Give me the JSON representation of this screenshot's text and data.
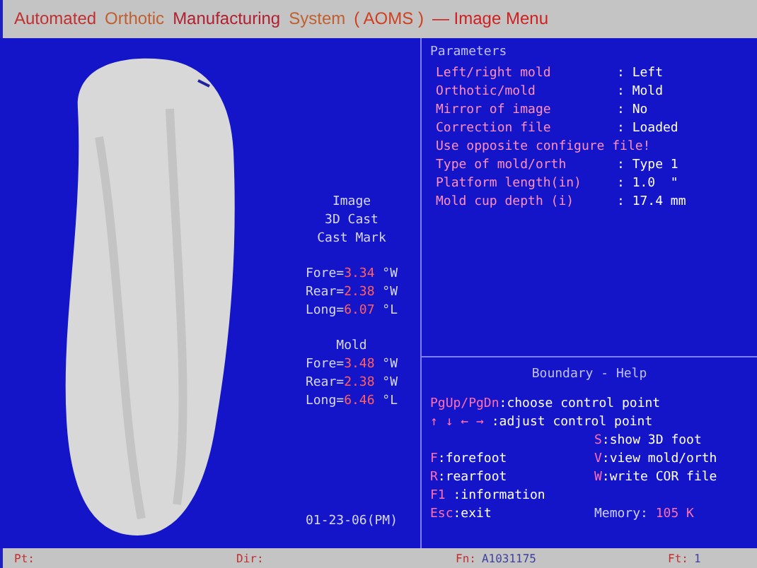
{
  "title": [
    {
      "text": "Automated",
      "color": "#c03030"
    },
    {
      "text": "Orthotic",
      "color": "#c06030"
    },
    {
      "text": "Manufacturing",
      "color": "#b02030"
    },
    {
      "text": "System",
      "color": "#c06030"
    },
    {
      "text": "( AOMS )",
      "color": "#d04020"
    },
    {
      "text": "— Image Menu",
      "color": "#d02020"
    }
  ],
  "image_info": {
    "headings": [
      "Image",
      "3D Cast",
      "Cast Mark"
    ],
    "cast": [
      {
        "label": "Fore=",
        "value": "3.34",
        "unit": "°W"
      },
      {
        "label": "Rear=",
        "value": "2.38",
        "unit": "°W"
      },
      {
        "label": "Long=",
        "value": "6.07",
        "unit": "°L"
      }
    ],
    "mold_heading": "Mold",
    "mold": [
      {
        "label": "Fore=",
        "value": "3.48",
        "unit": "°W"
      },
      {
        "label": "Rear=",
        "value": "2.38",
        "unit": "°W"
      },
      {
        "label": "Long=",
        "value": "6.46",
        "unit": "°L"
      }
    ],
    "date": "01-23-06(PM)"
  },
  "parameters": {
    "title": "Parameters",
    "rows": [
      {
        "kind": "pair",
        "label": "Left/right mold",
        "value": ": Left"
      },
      {
        "kind": "pair",
        "label": "Orthotic/mold",
        "value": ": Mold"
      },
      {
        "kind": "pair",
        "label": "Mirror of image",
        "value": ": No"
      },
      {
        "kind": "pair",
        "label": "Correction file",
        "value": ": Loaded"
      },
      {
        "kind": "note",
        "label": "Use opposite configure file!"
      },
      {
        "kind": "pair",
        "label": "Type of mold/orth",
        "value": ": Type 1"
      },
      {
        "kind": "pair",
        "label": "Platform length(in)",
        "value": ": 1.0  \""
      },
      {
        "kind": "pair",
        "label": "Mold cup depth (i)",
        "value": ": 17.4 mm"
      }
    ]
  },
  "help": {
    "title": "Boundary - Help",
    "lines": [
      {
        "kind": "wide",
        "key": "PgUp/PgDn",
        "text": ":choose control point"
      },
      {
        "kind": "wide",
        "key": "↑ ↓ ← →",
        "text": " :adjust control point"
      },
      {
        "kind": "right",
        "key": "S",
        "text": ":show 3D foot"
      },
      {
        "kind": "pair",
        "key": "F",
        "text": ":forefoot",
        "key2": "V",
        "text2": ":view mold/orth"
      },
      {
        "kind": "pair",
        "key": "R",
        "text": ":rearfoot",
        "key2": "W",
        "text2": ":write COR file"
      },
      {
        "kind": "wide",
        "key": "F1",
        "text": " :information"
      },
      {
        "kind": "memory",
        "key": "Esc",
        "text": ":exit",
        "key2": "Memory:",
        "text2": "105 K"
      }
    ]
  },
  "status_bar": [
    {
      "label": "Pt:"
    },
    {
      "label": "Dir:"
    },
    {
      "label": "Fn:",
      "value": "A1031175"
    },
    {
      "label": "Ft:",
      "value": "1"
    }
  ]
}
